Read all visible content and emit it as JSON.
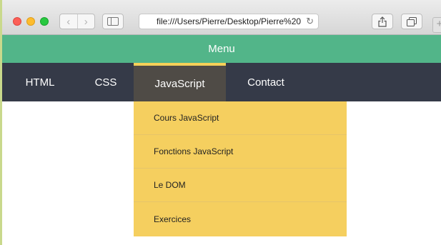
{
  "browser": {
    "nav_back_glyph": "‹",
    "nav_forward_glyph": "›",
    "address": "file:///Users/Pierre/Desktop/Pierre%20",
    "reload_glyph": "↻",
    "newtab_glyph": "+"
  },
  "page": {
    "menu_title": "Menu",
    "nav": [
      {
        "label": "HTML"
      },
      {
        "label": "CSS"
      },
      {
        "label": "JavaScript"
      },
      {
        "label": "Contact"
      }
    ],
    "dropdown": [
      {
        "label": "Cours JavaScript"
      },
      {
        "label": "Fonctions JavaScript"
      },
      {
        "label": "Le DOM"
      },
      {
        "label": "Exercices"
      }
    ]
  },
  "colors": {
    "menu_header": "#52b589",
    "navbar": "#353a48",
    "active_tab": "#4f4b46",
    "active_accent": "#f5d058",
    "dropdown": "#f5cf5f"
  }
}
